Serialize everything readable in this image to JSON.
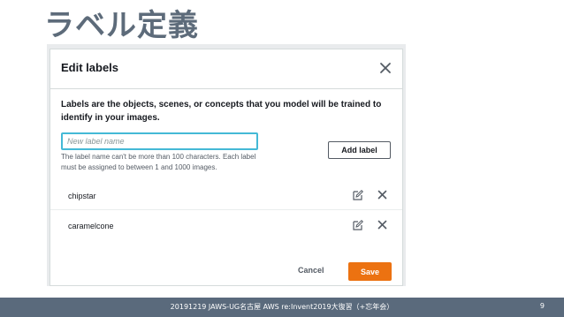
{
  "slide": {
    "title": "ラベル定義",
    "footer_text": "20191219 JAWS-UG名古屋 AWS re:Invent2019大復習（+忘年会）",
    "page_number": "9"
  },
  "modal": {
    "title": "Edit labels",
    "description": "Labels are the objects, scenes, or concepts that you model will be trained to identify in your images.",
    "input": {
      "value": "",
      "placeholder": "New label name"
    },
    "hint": "The label name can't be more than 100 characters. Each label must be assigned to between 1 and 1000 images.",
    "add_label_button": "Add label",
    "labels": [
      {
        "name": "chipstar"
      },
      {
        "name": "caramelcone"
      }
    ],
    "cancel_button": "Cancel",
    "save_button": "Save"
  },
  "colors": {
    "save_button": "#ec7211",
    "input_focus": "#44b9d6",
    "footer_bar": "#5a6a7c",
    "slide_title": "#5d6b7a"
  },
  "icons": {
    "close": "close-icon",
    "edit": "edit-icon",
    "delete": "delete-icon"
  }
}
